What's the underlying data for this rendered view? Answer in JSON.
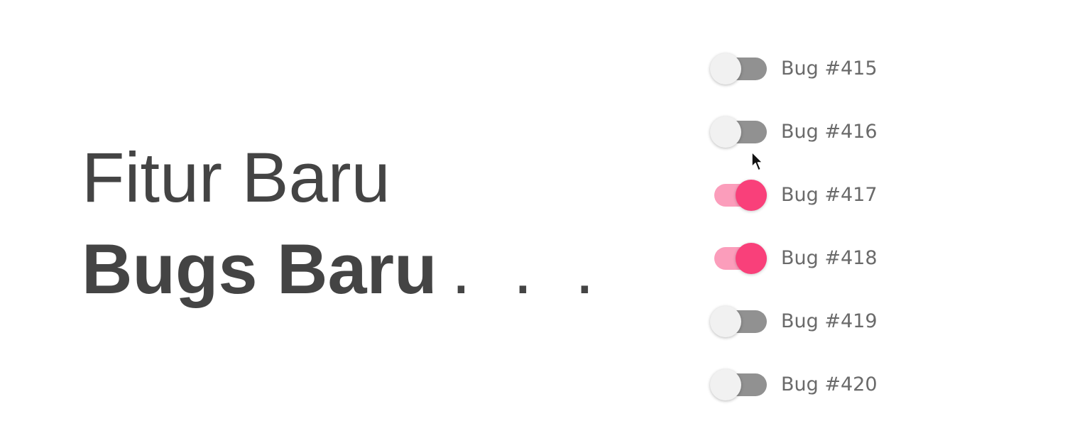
{
  "headline": {
    "line1": "Fitur Baru",
    "line2_bold": "Bugs Baru",
    "line2_suffix": ". . ."
  },
  "toggles": [
    {
      "label": "Bug #415",
      "checked": false
    },
    {
      "label": "Bug #416",
      "checked": false
    },
    {
      "label": "Bug #417",
      "checked": true
    },
    {
      "label": "Bug #418",
      "checked": true
    },
    {
      "label": "Bug #419",
      "checked": false
    },
    {
      "label": "Bug #420",
      "checked": false
    }
  ],
  "colors": {
    "text": "#444444",
    "label": "#6a6a6a",
    "track_off": "#919191",
    "thumb_off": "#f1f1f1",
    "track_on": "#fb9dbb",
    "thumb_on": "#f9407a"
  },
  "cursor": {
    "icon": "mouse-pointer-icon"
  }
}
